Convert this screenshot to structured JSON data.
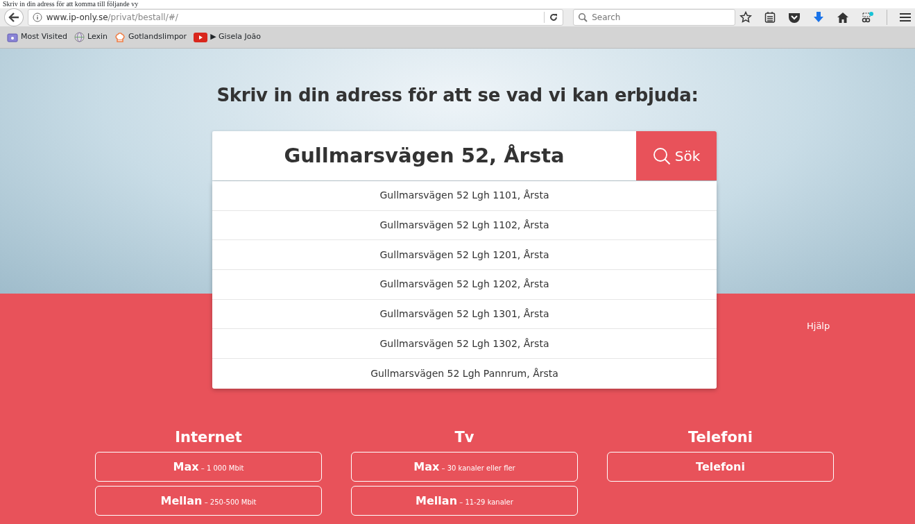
{
  "document_caption": "Skriv in din adress för att komma till följande vy",
  "browser": {
    "url_host": "www.ip-only.se",
    "url_path": "/privat/bestall/#/",
    "search_placeholder": "Search",
    "bookmarks": [
      {
        "label": "Most Visited",
        "kind": "folder"
      },
      {
        "label": "Lexin",
        "kind": "globe"
      },
      {
        "label": "Gotlandslimpor",
        "kind": "hat"
      },
      {
        "label": "▶ Gisela João",
        "kind": "video"
      }
    ]
  },
  "hero": {
    "heading": "Skriv in din adress för att se vad vi kan erbjuda:",
    "address_value": "Gullmarsvägen 52, Årsta",
    "search_button": "Sök",
    "suggestions": [
      {
        "label": "Gullmarsvägen 52 Lgh 1101, Årsta"
      },
      {
        "label": "Gullmarsvägen 52 Lgh 1102, Årsta"
      },
      {
        "label": "Gullmarsvägen 52 Lgh 1201, Årsta"
      },
      {
        "label": "Gullmarsvägen 52 Lgh 1202, Årsta"
      },
      {
        "label": "Gullmarsvägen 52 Lgh 1301, Årsta"
      },
      {
        "label": "Gullmarsvägen 52 Lgh 1302, Årsta"
      },
      {
        "label": "Gullmarsvägen 52 Lgh Pannrum, Årsta"
      }
    ]
  },
  "help_link": "Hjälp",
  "categories": [
    {
      "title": "Internet",
      "options": [
        {
          "name": "Max",
          "detail": "– 1 000 Mbit"
        },
        {
          "name": "Mellan",
          "detail": "– 250-500 Mbit"
        }
      ]
    },
    {
      "title": "Tv",
      "options": [
        {
          "name": "Max",
          "detail": "– 30 kanaler eller fler"
        },
        {
          "name": "Mellan",
          "detail": "– 11-29 kanaler"
        }
      ]
    },
    {
      "title": "Telefoni",
      "options": [
        {
          "name": "Telefoni"
        }
      ]
    }
  ]
}
